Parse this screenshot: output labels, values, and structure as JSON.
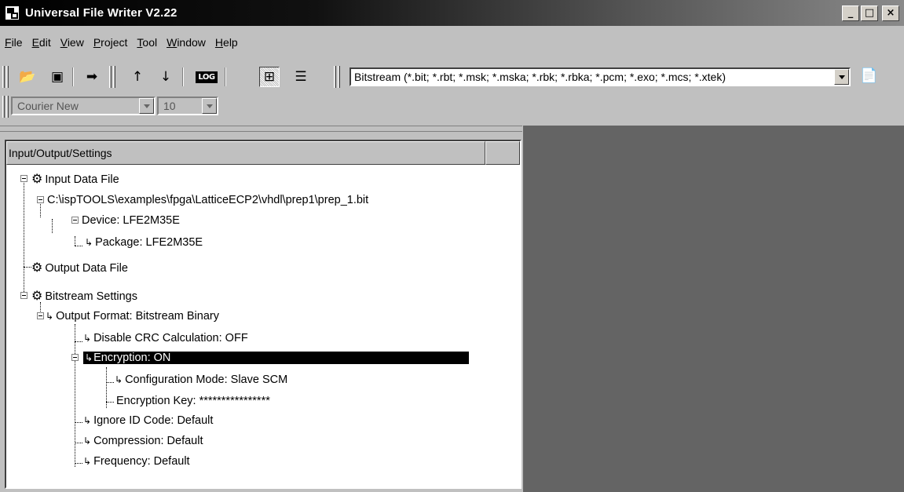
{
  "window": {
    "title": "Universal File Writer V2.22",
    "min_label": "_",
    "max_label": "□",
    "close_label": "×"
  },
  "menu": {
    "file": {
      "ul": "F",
      "rest": "ile"
    },
    "edit": {
      "ul": "E",
      "rest": "dit"
    },
    "view": {
      "ul": "V",
      "rest": "iew"
    },
    "project": {
      "ul": "P",
      "rest": "roject"
    },
    "tool": {
      "ul": "T",
      "rest": "ool"
    },
    "window": {
      "ul": "W",
      "rest": "indow"
    },
    "help": {
      "ul": "H",
      "rest": "elp"
    }
  },
  "toolbar": {
    "icons": [
      "open-folder-icon",
      "save-icon",
      "arrow-right-icon",
      "upload-icon",
      "download-icon",
      "log-icon",
      "tree-view-icon",
      "list-view-icon",
      "document-properties-icon"
    ],
    "log_label": "LOG",
    "file_type_value": "Bitstream (*.bit; *.rbt; *.msk; *.mska; *.rbk; *.rbka; *.pcm; *.exo; *.mcs; *.xtek)"
  },
  "font_toolbar": {
    "font_name": "Courier New",
    "font_size": "10"
  },
  "tree": {
    "header": "Input/Output/Settings",
    "input_data_file": "Input Data File",
    "input_path": "C:\\ispTOOLS\\examples\\fpga\\LatticeECP2\\vhdl\\prep1\\prep_1.bit",
    "device": "Device: LFE2M35E",
    "package": "Package: LFE2M35E",
    "output_data_file": "Output Data File",
    "bitstream_settings": "Bitstream  Settings",
    "output_format": "Output Format: Bitstream Binary",
    "disable_crc": "Disable CRC Calculation: OFF",
    "encryption": "Encryption: ON",
    "config_mode": "Configuration Mode: Slave SCM",
    "encryption_key": "Encryption Key: ****************",
    "ignore_id": "Ignore ID Code: Default",
    "compression": "Compression: Default",
    "frequency": "Frequency: Default"
  },
  "colors": {
    "titlebar_start": "#000000",
    "titlebar_end": "#8a8a8a",
    "face": "#c0c0c0",
    "workspace": "#646464",
    "selection": "#000000"
  }
}
